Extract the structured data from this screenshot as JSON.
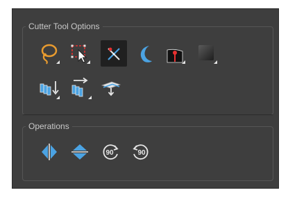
{
  "cutter_tool_options": {
    "title": "Cutter Tool Options",
    "tools": [
      {
        "icon": "lasso-icon",
        "selected": false,
        "has_menu": true
      },
      {
        "icon": "marquee-select-icon",
        "selected": false,
        "has_menu": true
      },
      {
        "icon": "cutter-crosshair-icon",
        "selected": true,
        "has_menu": false
      },
      {
        "icon": "crescent-shape-icon",
        "selected": false,
        "has_menu": false
      },
      {
        "icon": "red-pin-shape-icon",
        "selected": false,
        "has_menu": true
      },
      {
        "icon": "gradient-square-icon",
        "selected": false,
        "has_menu": true
      },
      {
        "icon": "paste-to-layer-icon",
        "selected": false,
        "has_menu": true
      },
      {
        "icon": "paste-to-drawing-icon",
        "selected": false,
        "has_menu": true
      },
      {
        "icon": "drawing-layer-flatten-icon",
        "selected": false,
        "has_menu": false
      }
    ]
  },
  "operations": {
    "title": "Operations",
    "tools": [
      {
        "icon": "flip-horizontal-icon"
      },
      {
        "icon": "flip-vertical-icon"
      },
      {
        "icon": "rotate-90-cw-icon",
        "label": "90"
      },
      {
        "icon": "rotate-90-ccw-icon",
        "label": "90"
      }
    ]
  },
  "colors": {
    "panel_bg": "#3e3e3e",
    "accent_blue": "#4ba3e3",
    "accent_orange": "#e89b2f",
    "accent_red": "#e83030"
  }
}
